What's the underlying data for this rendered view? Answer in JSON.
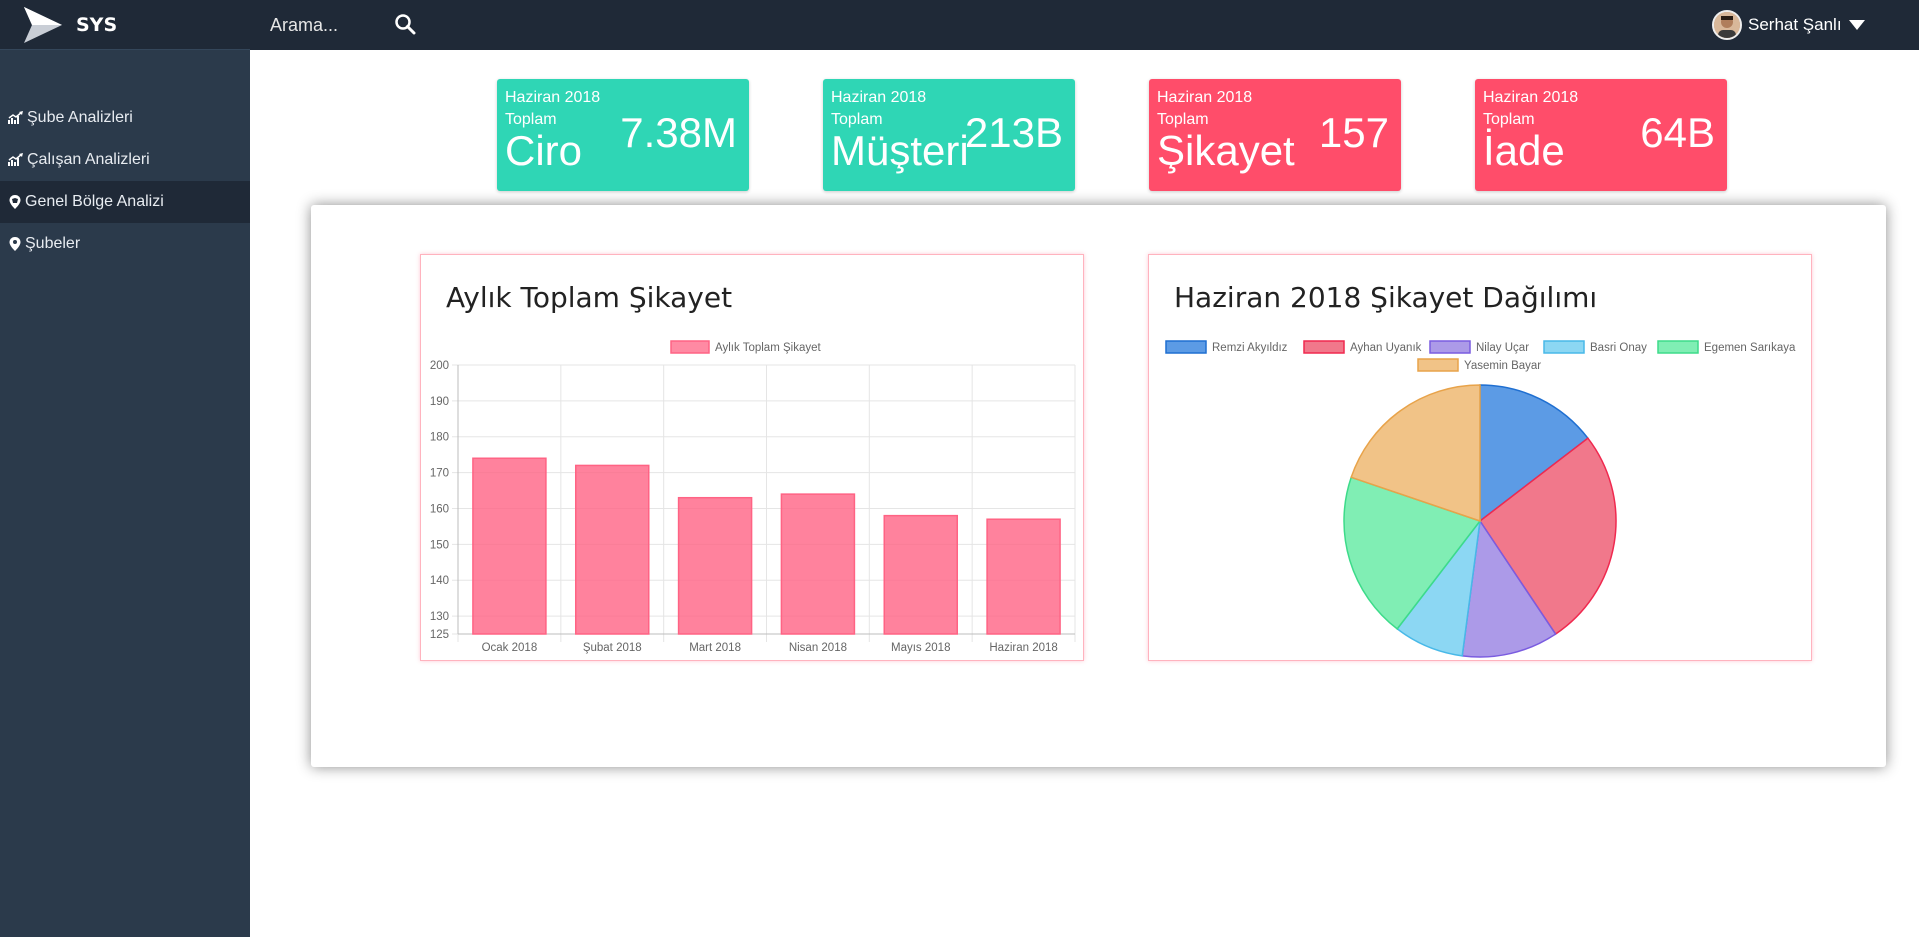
{
  "brand": {
    "name": "SYS"
  },
  "sidebar": {
    "items": [
      {
        "label": "Şube Analizleri",
        "icon": "chart-up-icon",
        "active": false
      },
      {
        "label": "Çalışan Analizleri",
        "icon": "chart-up-icon",
        "active": false
      },
      {
        "label": "Genel Bölge Analizi",
        "icon": "map-marker-icon",
        "active": true
      },
      {
        "label": "Şubeler",
        "icon": "map-marker-icon",
        "active": false
      }
    ]
  },
  "topbar": {
    "search_placeholder": "Arama...",
    "user_name": "Serhat Şanlı"
  },
  "stats": [
    {
      "period": "Haziran 2018",
      "total": "Toplam",
      "label": "Ciro",
      "value": "7.38M",
      "color": "#2fd6b5"
    },
    {
      "period": "Haziran 2018",
      "total": "Toplam",
      "label": "Müşteri",
      "value": "213B",
      "color": "#2fd6b5"
    },
    {
      "period": "Haziran 2018",
      "total": "Toplam",
      "label": "Şikayet",
      "value": "157",
      "color": "#ff4d6a"
    },
    {
      "period": "Haziran 2018",
      "total": "Toplam",
      "label": "İade",
      "value": "64B",
      "color": "#ff4d6a"
    }
  ],
  "cards": {
    "bar_title": "Aylık Toplam Şikayet",
    "pie_title": "Haziran 2018 Şikayet Dağılımı"
  },
  "chart_data": [
    {
      "type": "bar",
      "title": "",
      "categories": [
        "Ocak 2018",
        "Şubat 2018",
        "Mart 2018",
        "Nisan 2018",
        "Mayıs 2018",
        "Haziran 2018"
      ],
      "series": [
        {
          "name": "Aylık Toplam Şikayet",
          "values": [
            174,
            172,
            163,
            164,
            158,
            157
          ],
          "color": "#ff6384"
        }
      ],
      "yticks": [
        125,
        130,
        140,
        150,
        160,
        170,
        180,
        190,
        200
      ],
      "ylim": [
        125,
        200
      ],
      "grid": true,
      "legend": "top"
    },
    {
      "type": "pie",
      "title": "",
      "labels": [
        "Remzi Akyıldız",
        "Ayhan Uyanık",
        "Nilay Uçar",
        "Basri Onay",
        "Egemen Sarıkaya",
        "Yasemin Bayar"
      ],
      "values": [
        14,
        25,
        11,
        8,
        19,
        19
      ],
      "colors": [
        "#4a90e2",
        "#f0697e",
        "#a38fe6",
        "#7fd3f2",
        "#72ecac",
        "#f0bd7a"
      ],
      "borders": [
        "#1f6fd1",
        "#f0294f",
        "#7a5ce0",
        "#48b9e8",
        "#3ddb8a",
        "#e8a34a"
      ],
      "legend": "top"
    }
  ]
}
